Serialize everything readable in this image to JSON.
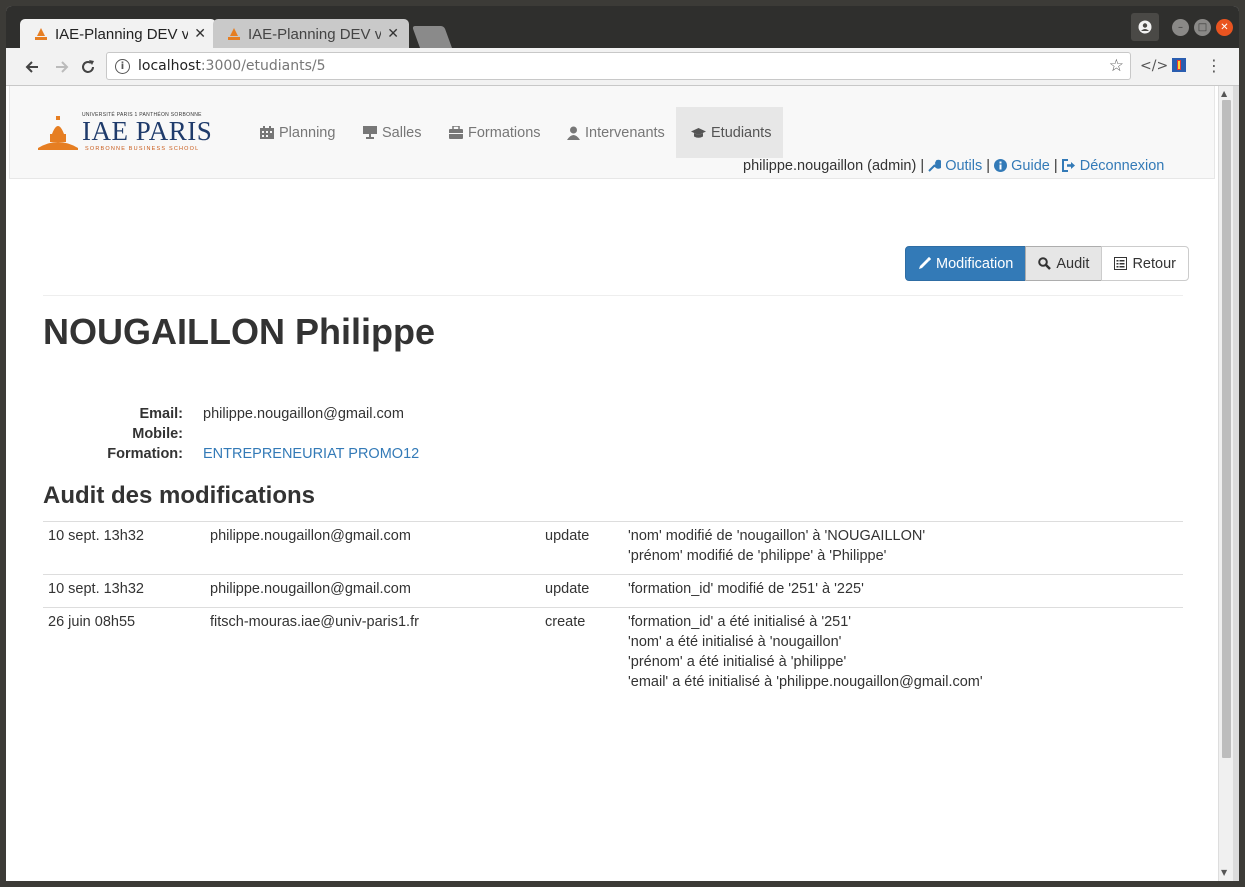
{
  "browser": {
    "tabs": [
      {
        "title": "IAE-Planning DEV v",
        "active": true
      },
      {
        "title": "IAE-Planning DEV v",
        "active": false
      }
    ],
    "url_host": "localhost",
    "url_path": ":3000/etudiants/5"
  },
  "navbar": {
    "logo": {
      "line1": "UNIVERSITÉ PARIS 1 PANTHÉON SORBONNE",
      "line2": "IAE PARIS",
      "line3": "SORBONNE BUSINESS SCHOOL"
    },
    "items": [
      {
        "label": "Planning",
        "icon": "calendar-icon"
      },
      {
        "label": "Salles",
        "icon": "easel-icon"
      },
      {
        "label": "Formations",
        "icon": "briefcase-icon"
      },
      {
        "label": "Intervenants",
        "icon": "user-icon"
      },
      {
        "label": "Etudiants",
        "icon": "graduation-cap-icon",
        "active": true
      }
    ],
    "user": "philippe.nougaillon (admin)",
    "sep": "|",
    "tools": "Outils",
    "guide": "Guide",
    "logout": "Déconnexion"
  },
  "actions": {
    "edit": "Modification",
    "audit": "Audit",
    "back": "Retour"
  },
  "student": {
    "name": "NOUGAILLON Philippe",
    "email_label": "Email:",
    "email": "philippe.nougaillon@gmail.com",
    "mobile_label": "Mobile:",
    "mobile": "",
    "formation_label": "Formation:",
    "formation": "ENTREPRENEURIAT PROMO12"
  },
  "audit": {
    "title": "Audit des modifications",
    "rows": [
      {
        "date": "10 sept. 13h32",
        "user": "philippe.nougaillon@gmail.com",
        "action": "update",
        "changes": [
          "'nom' modifié de 'nougaillon' à 'NOUGAILLON'",
          "'prénom' modifié de 'philippe' à 'Philippe'"
        ]
      },
      {
        "date": "10 sept. 13h32",
        "user": "philippe.nougaillon@gmail.com",
        "action": "update",
        "changes": [
          "'formation_id' modifié de '251' à '225'"
        ]
      },
      {
        "date": "26 juin 08h55",
        "user": "fitsch-mouras.iae@univ-paris1.fr",
        "action": "create",
        "changes": [
          "'formation_id' a été initialisé à '251'",
          "'nom' a été initialisé à 'nougaillon'",
          "'prénom' a été initialisé à 'philippe'",
          "'email' a été initialisé à 'philippe.nougaillon@gmail.com'"
        ]
      }
    ]
  },
  "colors": {
    "link": "#337ab7",
    "primary": "#337ab7",
    "logo_blue": "#1f3b6b",
    "logo_orange": "#e67e22"
  }
}
